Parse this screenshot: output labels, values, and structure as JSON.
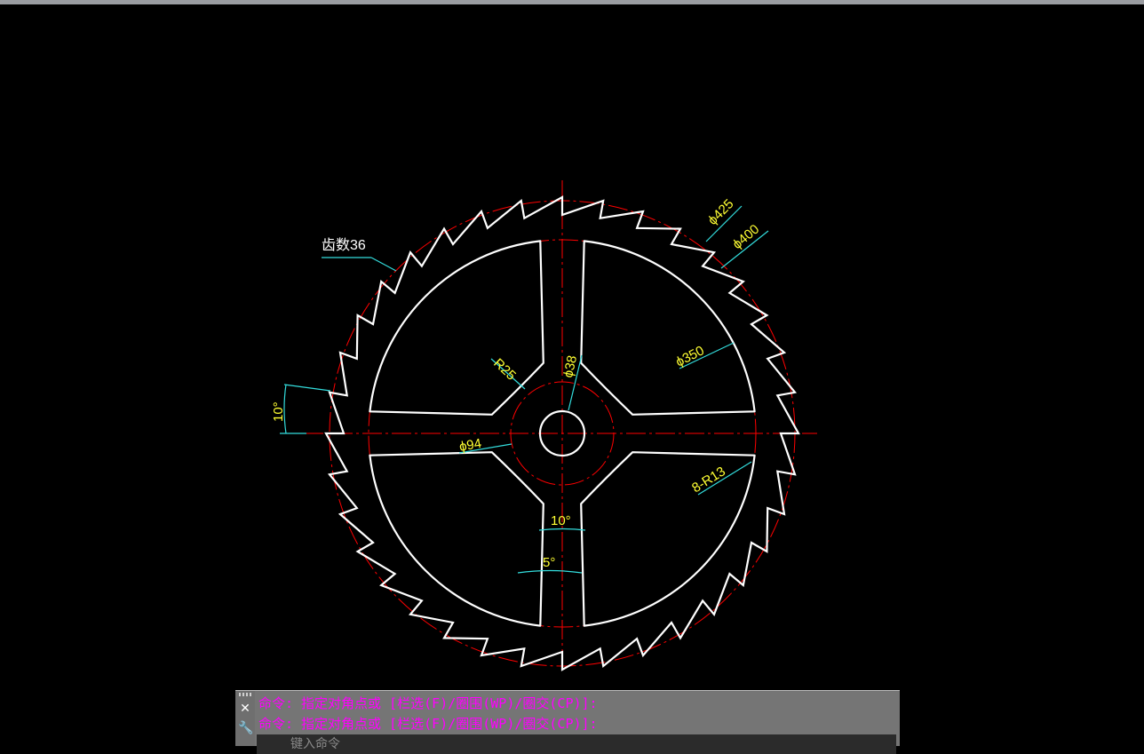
{
  "drawing": {
    "annotations": {
      "teeth_count": "齿数36",
      "dia_425": "ϕ425",
      "dia_400": "ϕ400",
      "dia_350": "ϕ350",
      "dia_94": "ϕ94",
      "dia_38": "ϕ38",
      "radius_25": "R25",
      "radius_13": "8-R13",
      "angle_10_left": "10°",
      "angle_10_spoke": "10°",
      "angle_5_spoke": "5°"
    },
    "colors": {
      "background": "#000000",
      "geometry": "#ffffff",
      "centerline": "#ff0000",
      "dimension_text": "#ffff00",
      "dimension_line": "#00ffff"
    }
  },
  "command_line": {
    "close_icon": "close-icon",
    "settings_icon": "wrench-icon",
    "history": [
      "命令: 指定对角点或 [栏选(F)/圈围(WP)/圈交(CP)]:",
      "命令: 指定对角点或 [栏选(F)/圈围(WP)/圈交(CP)]:"
    ],
    "input_placeholder": "键入命令",
    "text_color": "#ff00ff"
  }
}
